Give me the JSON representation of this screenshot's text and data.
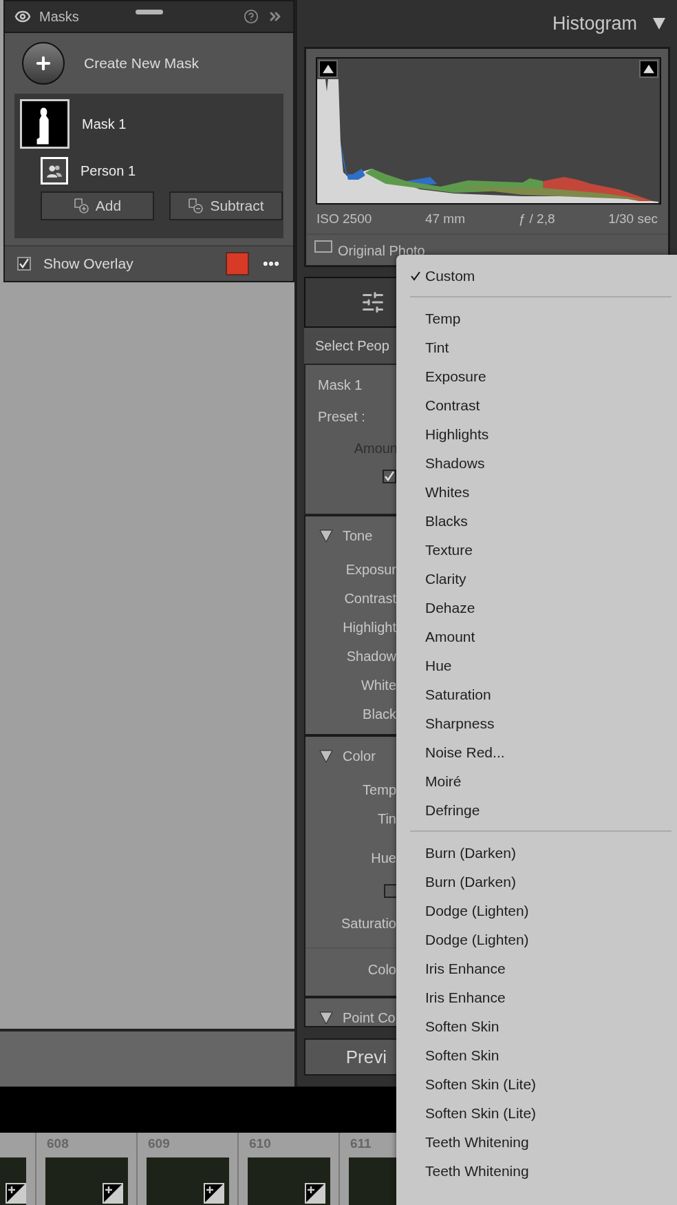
{
  "masks_panel": {
    "title": "Masks",
    "create_label": "Create New Mask",
    "masks": [
      {
        "name": "Mask 1",
        "selected": true,
        "components": [
          {
            "name": "Person 1",
            "selected": false
          }
        ]
      }
    ],
    "buttons": [
      {
        "kind": "add",
        "label": "Add"
      },
      {
        "kind": "subtract",
        "label": "Subtract"
      }
    ],
    "show_overlay": {
      "label": "Show Overlay",
      "checked": true,
      "color": "#d93a26"
    }
  },
  "histogram": {
    "title": "Histogram",
    "exif": [
      "ISO 2500",
      "47 mm",
      "ƒ / 2,8",
      "1/30 sec"
    ],
    "original_photo": {
      "label": "Original Photo",
      "checked": false
    }
  },
  "edit_panel": {
    "tab": "Select Peop",
    "mask": {
      "name": "Mask 1",
      "preset_label": "Preset :",
      "amount_label": "Amoun",
      "invert_checked": true
    },
    "sections": [
      {
        "title": "Tone",
        "expanded": true,
        "rows": [
          {
            "kind": "label",
            "label": "Exposur"
          },
          {
            "kind": "label",
            "label": "Contrast"
          },
          {
            "kind": "label",
            "label": "Highlight"
          },
          {
            "kind": "label",
            "label": "Shadow"
          },
          {
            "kind": "label",
            "label": "White"
          },
          {
            "kind": "label",
            "label": "Black"
          }
        ]
      },
      {
        "title": "Color",
        "expanded": true,
        "rows": [
          {
            "kind": "label",
            "label": "Temp"
          },
          {
            "kind": "label",
            "label": "Tin"
          },
          {
            "kind": "spaced",
            "label": "Hue"
          },
          {
            "kind": "checkbox",
            "checked": false
          },
          {
            "kind": "label",
            "label": "Saturatio"
          },
          {
            "kind": "divided",
            "label": "Colo"
          }
        ]
      },
      {
        "title": "Point Co",
        "expanded": true
      }
    ],
    "preview_button": "Previ"
  },
  "menu": {
    "groups": [
      {
        "items": [
          {
            "label": "Custom",
            "selected": true
          }
        ]
      },
      {
        "items": [
          {
            "label": "Temp",
            "selected": false
          },
          {
            "label": "Tint",
            "selected": false
          },
          {
            "label": "Exposure",
            "selected": false
          },
          {
            "label": "Contrast",
            "selected": false
          },
          {
            "label": "Highlights",
            "selected": false
          },
          {
            "label": "Shadows",
            "selected": false
          },
          {
            "label": "Whites",
            "selected": false
          },
          {
            "label": "Blacks",
            "selected": false
          },
          {
            "label": "Texture",
            "selected": false
          },
          {
            "label": "Clarity",
            "selected": false
          },
          {
            "label": "Dehaze",
            "selected": false
          },
          {
            "label": "Amount",
            "selected": false
          },
          {
            "label": "Hue",
            "selected": false
          },
          {
            "label": "Saturation",
            "selected": false
          },
          {
            "label": "Sharpness",
            "selected": false
          },
          {
            "label": "Noise Red...",
            "selected": false
          },
          {
            "label": "Moiré",
            "selected": false
          },
          {
            "label": "Defringe",
            "selected": false
          }
        ]
      },
      {
        "items": [
          {
            "label": "Burn (Darken)",
            "selected": false
          },
          {
            "label": "Burn (Darken)",
            "selected": false
          },
          {
            "label": "Dodge (Lighten)",
            "selected": false
          },
          {
            "label": "Dodge (Lighten)",
            "selected": false
          },
          {
            "label": "Iris Enhance",
            "selected": false
          },
          {
            "label": "Iris Enhance",
            "selected": false
          },
          {
            "label": "Soften Skin",
            "selected": false
          },
          {
            "label": "Soften Skin",
            "selected": false
          },
          {
            "label": "Soften Skin (Lite)",
            "selected": false
          },
          {
            "label": "Soften Skin (Lite)",
            "selected": false
          },
          {
            "label": "Teeth Whitening",
            "selected": false
          },
          {
            "label": "Teeth Whitening",
            "selected": false
          }
        ]
      }
    ]
  },
  "filmstrip": [
    {
      "kind": "partial"
    },
    {
      "kind": "frame",
      "number": "608"
    },
    {
      "kind": "frame",
      "number": "609"
    },
    {
      "kind": "frame",
      "number": "610"
    },
    {
      "kind": "frame",
      "number": "611"
    }
  ]
}
